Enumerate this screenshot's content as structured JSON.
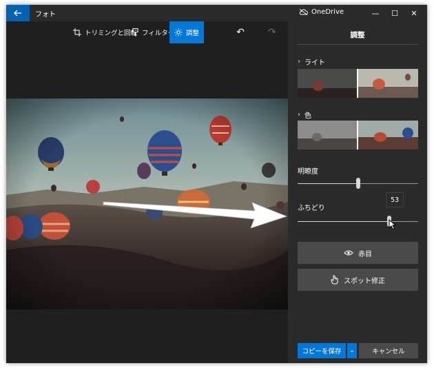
{
  "titlebar": {
    "back_icon": "back-arrow-icon",
    "app_title": "フォト",
    "onedrive_label": "OneDrive",
    "onedrive_icon": "cloud-off-icon",
    "minimize_glyph": "—",
    "maximize_glyph": "☐",
    "close_glyph": "✕"
  },
  "toolbar": {
    "crop_label": "トリミングと回転",
    "filter_label": "フィルター",
    "adjust_label": "調整",
    "undo_glyph": "↶",
    "redo_glyph": "↷",
    "accent": "#0078d7"
  },
  "panel": {
    "title": "調整",
    "light_label": "ライト",
    "color_label": "色",
    "clarity_label": "明瞭度",
    "clarity_value_fraction": 0.5,
    "vignette_label": "ふちどり",
    "vignette_value": "53",
    "vignette_value_fraction": 0.76,
    "redeye_label": "赤目",
    "spot_fix_label": "スポット修正",
    "save_copy_label": "コピーを保存",
    "save_dropdown_glyph": "⌄",
    "cancel_label": "キャンセル"
  }
}
